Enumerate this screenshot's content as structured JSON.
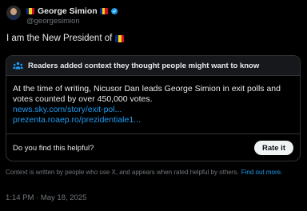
{
  "author": {
    "display_name": "George Simion",
    "handle": "@georgesimion",
    "verified": true,
    "avatar": "profile-photo"
  },
  "post": {
    "text": "I am the New President of",
    "emoji": "flag-romania"
  },
  "community_note": {
    "title": "Readers added context they thought people might want to know",
    "icon": "people-icon",
    "body": "At the time of writing, Nicusor Dan leads George Simion in exit polls and votes counted by over 450,000 votes.",
    "links": [
      "news.sky.com/story/exit-pol...",
      "prezenta.roaep.ro/prezidentiale1..."
    ],
    "helpful_question": "Do you find this helpful?",
    "rate_label": "Rate it"
  },
  "context_footer": {
    "text": "Context is written by people who use X, and appears when rated helpful by others.",
    "link": "Find out more."
  },
  "timestamp": "1:14 PM · May 18, 2025",
  "colors": {
    "background": "#000000",
    "text": "#e7e9ea",
    "muted": "#71767b",
    "link": "#1d9bf0",
    "border": "#2f3336",
    "flag_blue": "#002B7F",
    "flag_yellow": "#FCD116",
    "flag_red": "#CE1126",
    "verified": "#1d9bf0"
  }
}
